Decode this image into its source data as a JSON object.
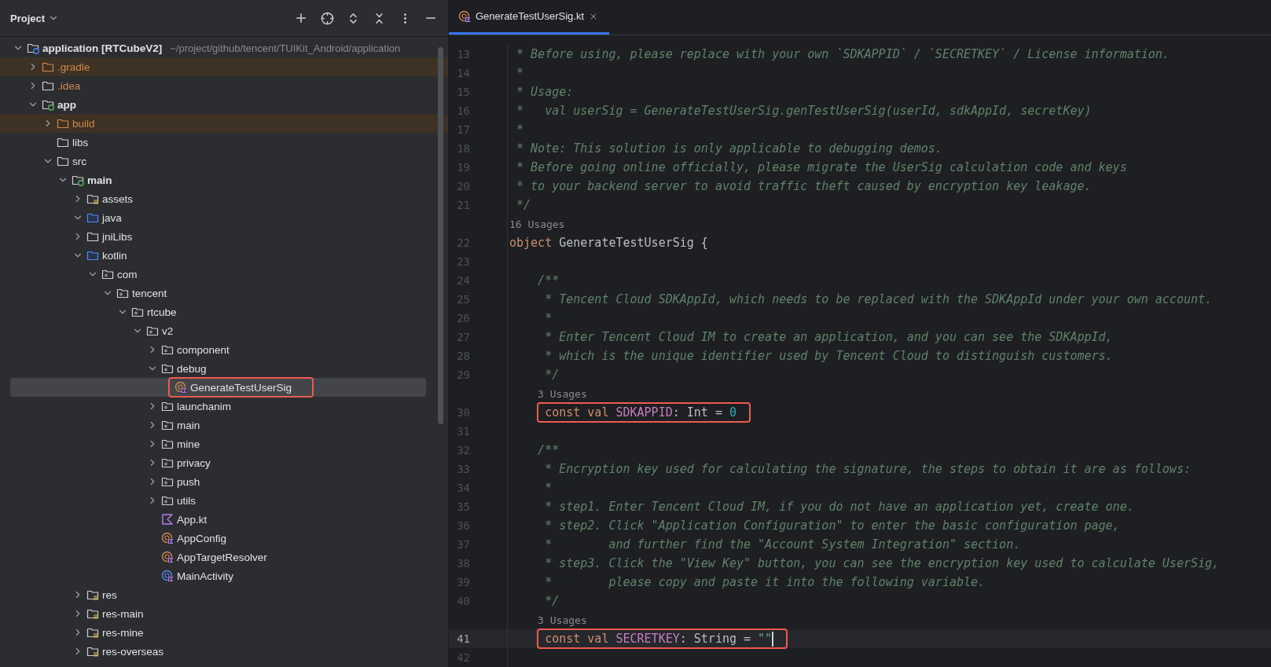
{
  "project_panel": {
    "title": "Project",
    "tree": [
      {
        "name": "application [RTCubeV2]",
        "path": "~/project/github/tencent/TUIKit_Android/application",
        "kind": "root",
        "expanded": true,
        "selected": false,
        "children": [
          {
            "name": ".gradle",
            "kind": "excluded",
            "expanded": false,
            "selected": false
          },
          {
            "name": ".idea",
            "kind": "ignored",
            "expanded": false,
            "selected": false
          },
          {
            "name": "app",
            "kind": "module",
            "expanded": true,
            "selected": false,
            "children": [
              {
                "name": "build",
                "kind": "excluded",
                "expanded": false,
                "selected": false
              },
              {
                "name": "libs",
                "kind": "folder",
                "selected": false
              },
              {
                "name": "src",
                "kind": "folder",
                "expanded": true,
                "selected": false,
                "children": [
                  {
                    "name": "main",
                    "kind": "module",
                    "expanded": true,
                    "selected": false,
                    "children": [
                      {
                        "name": "assets",
                        "kind": "resources",
                        "expanded": false,
                        "selected": false
                      },
                      {
                        "name": "java",
                        "kind": "source",
                        "expanded": true,
                        "selected": false
                      },
                      {
                        "name": "jniLibs",
                        "kind": "folder",
                        "expanded": false,
                        "selected": false
                      },
                      {
                        "name": "kotlin",
                        "kind": "source",
                        "expanded": true,
                        "selected": false,
                        "children": [
                          {
                            "name": "com",
                            "kind": "package",
                            "expanded": true,
                            "selected": false,
                            "children": [
                              {
                                "name": "tencent",
                                "kind": "package",
                                "expanded": true,
                                "selected": false,
                                "children": [
                                  {
                                    "name": "rtcube",
                                    "kind": "package",
                                    "expanded": true,
                                    "selected": false,
                                    "children": [
                                      {
                                        "name": "v2",
                                        "kind": "package",
                                        "expanded": true,
                                        "selected": false,
                                        "children": [
                                          {
                                            "name": "component",
                                            "kind": "package",
                                            "expanded": false,
                                            "selected": false
                                          },
                                          {
                                            "name": "debug",
                                            "kind": "package",
                                            "expanded": true,
                                            "selected": false,
                                            "children": [
                                              {
                                                "name": "GenerateTestUserSig",
                                                "kind": "kotlin-class",
                                                "selected": true,
                                                "outlined": true
                                              }
                                            ]
                                          },
                                          {
                                            "name": "launchanim",
                                            "kind": "package",
                                            "expanded": false,
                                            "selected": false
                                          },
                                          {
                                            "name": "main",
                                            "kind": "package",
                                            "expanded": false,
                                            "selected": false
                                          },
                                          {
                                            "name": "mine",
                                            "kind": "package",
                                            "expanded": false,
                                            "selected": false
                                          },
                                          {
                                            "name": "privacy",
                                            "kind": "package",
                                            "expanded": false,
                                            "selected": false
                                          },
                                          {
                                            "name": "push",
                                            "kind": "package",
                                            "expanded": false,
                                            "selected": false
                                          },
                                          {
                                            "name": "utils",
                                            "kind": "package",
                                            "expanded": false,
                                            "selected": false
                                          },
                                          {
                                            "name": "App.kt",
                                            "kind": "kotlin-file",
                                            "selected": false
                                          },
                                          {
                                            "name": "AppConfig",
                                            "kind": "kotlin-class",
                                            "selected": false
                                          },
                                          {
                                            "name": "AppTargetResolver",
                                            "kind": "kotlin-class",
                                            "selected": false
                                          },
                                          {
                                            "name": "MainActivity",
                                            "kind": "activity",
                                            "selected": false
                                          }
                                        ]
                                      }
                                    ]
                                  }
                                ]
                              }
                            ]
                          }
                        ]
                      },
                      {
                        "name": "res",
                        "kind": "resources",
                        "expanded": false,
                        "selected": false
                      },
                      {
                        "name": "res-main",
                        "kind": "resources",
                        "expanded": false,
                        "selected": false
                      },
                      {
                        "name": "res-mine",
                        "kind": "resources",
                        "expanded": false,
                        "selected": false
                      },
                      {
                        "name": "res-overseas",
                        "kind": "resources",
                        "expanded": false,
                        "selected": false
                      }
                    ]
                  }
                ]
              }
            ]
          }
        ]
      }
    ]
  },
  "editor": {
    "tabs": [
      {
        "label": "GenerateTestUserSig.kt",
        "selected": true
      }
    ],
    "lines": [
      {
        "kind": "code",
        "number": "13",
        "current": false,
        "tokens": [
          {
            "kind": "comment",
            "text": " * Before using, please replace with your own `SDKAPPID` / `SECRETKEY` / License information."
          }
        ]
      },
      {
        "kind": "code",
        "number": "14",
        "current": false,
        "tokens": [
          {
            "kind": "comment",
            "text": " *"
          }
        ]
      },
      {
        "kind": "code",
        "number": "15",
        "current": false,
        "tokens": [
          {
            "kind": "comment",
            "text": " * Usage:"
          }
        ]
      },
      {
        "kind": "code",
        "number": "16",
        "current": false,
        "tokens": [
          {
            "kind": "comment",
            "text": " *   val userSig = GenerateTestUserSig.genTestUserSig(userId, sdkAppId, secretKey)"
          }
        ]
      },
      {
        "kind": "code",
        "number": "17",
        "current": false,
        "tokens": [
          {
            "kind": "comment",
            "text": " *"
          }
        ]
      },
      {
        "kind": "code",
        "number": "18",
        "current": false,
        "tokens": [
          {
            "kind": "comment",
            "text": " * Note: This solution is only applicable to debugging demos."
          }
        ]
      },
      {
        "kind": "code",
        "number": "19",
        "current": false,
        "tokens": [
          {
            "kind": "comment",
            "text": " * Before going online officially, please migrate the UserSig calculation code and keys"
          }
        ]
      },
      {
        "kind": "code",
        "number": "20",
        "current": false,
        "tokens": [
          {
            "kind": "comment",
            "text": " * to your backend server to avoid traffic theft caused by encryption key leakage."
          }
        ]
      },
      {
        "kind": "code",
        "number": "21",
        "current": false,
        "tokens": [
          {
            "kind": "comment",
            "text": " */"
          }
        ]
      },
      {
        "kind": "usages",
        "text": "16 Usages"
      },
      {
        "kind": "code",
        "number": "22",
        "current": false,
        "tokens": [
          {
            "kind": "keyword",
            "text": "object"
          },
          {
            "kind": "plain",
            "text": " GenerateTestUserSig {"
          }
        ]
      },
      {
        "kind": "code",
        "number": "23",
        "current": false
      },
      {
        "kind": "code",
        "number": "24",
        "current": false,
        "tokens": [
          {
            "kind": "comment",
            "text": "    /**"
          }
        ]
      },
      {
        "kind": "code",
        "number": "25",
        "current": false,
        "tokens": [
          {
            "kind": "comment",
            "text": "     * Tencent Cloud SDKAppId, which needs to be replaced with the SDKAppId under your own account."
          }
        ]
      },
      {
        "kind": "code",
        "number": "26",
        "current": false,
        "tokens": [
          {
            "kind": "comment",
            "text": "     *"
          }
        ]
      },
      {
        "kind": "code",
        "number": "27",
        "current": false,
        "tokens": [
          {
            "kind": "comment",
            "text": "     * Enter Tencent Cloud IM to create an application, and you can see the SDKAppId,"
          }
        ]
      },
      {
        "kind": "code",
        "number": "28",
        "current": false,
        "tokens": [
          {
            "kind": "comment",
            "text": "     * which is the unique identifier used by Tencent Cloud to distinguish customers."
          }
        ]
      },
      {
        "kind": "code",
        "number": "29",
        "current": false,
        "tokens": [
          {
            "kind": "comment",
            "text": "     */"
          }
        ]
      },
      {
        "kind": "usages",
        "text": "3 Usages"
      },
      {
        "kind": "code",
        "number": "30",
        "current": false,
        "outlined": true,
        "tokens": [
          {
            "kind": "keyword",
            "text": "const val "
          },
          {
            "kind": "constant",
            "text": "SDKAPPID"
          },
          {
            "kind": "plain",
            "text": ": Int = "
          },
          {
            "kind": "number",
            "text": "0"
          }
        ]
      },
      {
        "kind": "code",
        "number": "31",
        "current": false
      },
      {
        "kind": "code",
        "number": "32",
        "current": false,
        "tokens": [
          {
            "kind": "comment",
            "text": "    /**"
          }
        ]
      },
      {
        "kind": "code",
        "number": "33",
        "current": false,
        "tokens": [
          {
            "kind": "comment",
            "text": "     * Encryption key used for calculating the signature, the steps to obtain it are as follows:"
          }
        ]
      },
      {
        "kind": "code",
        "number": "34",
        "current": false,
        "tokens": [
          {
            "kind": "comment",
            "text": "     *"
          }
        ]
      },
      {
        "kind": "code",
        "number": "35",
        "current": false,
        "tokens": [
          {
            "kind": "comment",
            "text": "     * step1. Enter Tencent Cloud IM, if you do not have an application yet, create one."
          }
        ]
      },
      {
        "kind": "code",
        "number": "36",
        "current": false,
        "tokens": [
          {
            "kind": "comment",
            "text": "     * step2. Click \"Application Configuration\" to enter the basic configuration page,"
          }
        ]
      },
      {
        "kind": "code",
        "number": "37",
        "current": false,
        "tokens": [
          {
            "kind": "comment",
            "text": "     *        and further find the \"Account System Integration\" section."
          }
        ]
      },
      {
        "kind": "code",
        "number": "38",
        "current": false,
        "tokens": [
          {
            "kind": "comment",
            "text": "     * step3. Click the \"View Key\" button, you can see the encryption key used to calculate UserSig,"
          }
        ]
      },
      {
        "kind": "code",
        "number": "39",
        "current": false,
        "tokens": [
          {
            "kind": "comment",
            "text": "     *        please copy and paste it into the following variable."
          }
        ]
      },
      {
        "kind": "code",
        "number": "40",
        "current": false,
        "tokens": [
          {
            "kind": "comment",
            "text": "     */"
          }
        ]
      },
      {
        "kind": "usages",
        "text": "3 Usages"
      },
      {
        "kind": "code",
        "number": "41",
        "current": true,
        "outlined": true,
        "tokens": [
          {
            "kind": "keyword",
            "text": "const val "
          },
          {
            "kind": "constant",
            "text": "SECRETKEY"
          },
          {
            "kind": "plain",
            "text": ": String = "
          },
          {
            "kind": "string",
            "text": "\"\""
          }
        ]
      },
      {
        "kind": "code",
        "number": "42",
        "current": false
      }
    ]
  }
}
